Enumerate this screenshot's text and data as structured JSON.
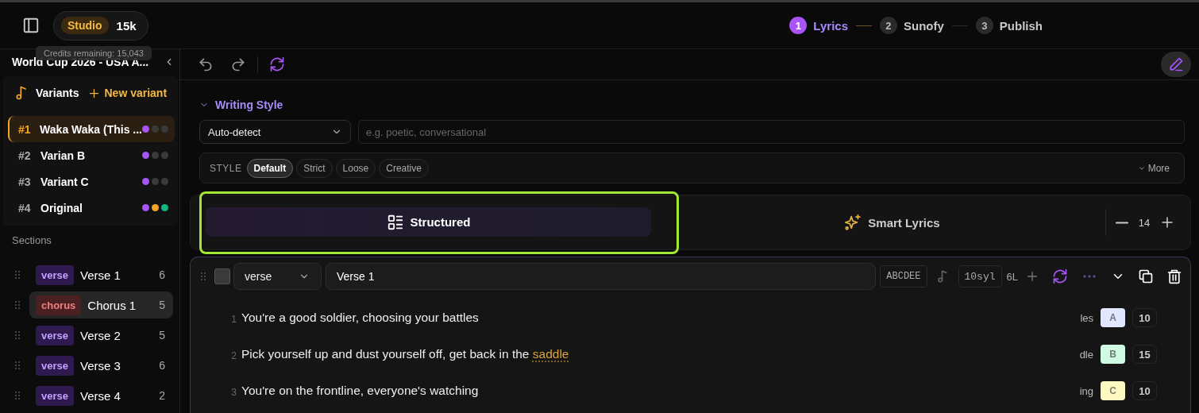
{
  "topbar": {
    "plan_badge": "Studio",
    "credits": "15k",
    "tooltip": "Credits remaining: 15,043",
    "steps": [
      {
        "number": "1",
        "label": "Lyrics",
        "selected": true
      },
      {
        "number": "2",
        "label": "Sunofy",
        "selected": false
      },
      {
        "number": "3",
        "label": "Publish",
        "selected": false
      }
    ]
  },
  "sidebar": {
    "project_title": "World Cup 2026 - USA A...",
    "variants_label": "Variants",
    "new_variant": "New variant",
    "variants": [
      {
        "number": "#1",
        "name": "Waka Waka (This ...",
        "selected": true,
        "dots": [
          {
            "color": "#a855f7"
          },
          {
            "color": "#3a3a3a"
          },
          {
            "color": "#3a3a3a"
          }
        ]
      },
      {
        "number": "#2",
        "name": "Varian B",
        "selected": false,
        "dots": [
          {
            "color": "#a855f7"
          },
          {
            "color": "#3a3a3a"
          },
          {
            "color": "#3a3a3a"
          }
        ]
      },
      {
        "number": "#3",
        "name": "Variant C",
        "selected": false,
        "dots": [
          {
            "color": "#a855f7"
          },
          {
            "color": "#3a3a3a"
          },
          {
            "color": "#3a3a3a"
          }
        ]
      },
      {
        "number": "#4",
        "name": "Original",
        "selected": false,
        "dots": [
          {
            "color": "#a855f7"
          },
          {
            "color": "#f5a524"
          },
          {
            "color": "#10b981"
          }
        ]
      }
    ],
    "sections_label": "Sections",
    "sections": [
      {
        "kind": "verse",
        "tag": "verse",
        "name": "Verse 1",
        "count": "6",
        "selected": false
      },
      {
        "kind": "chorus",
        "tag": "chorus",
        "name": "Chorus 1",
        "count": "5",
        "selected": true
      },
      {
        "kind": "verse",
        "tag": "verse",
        "name": "Verse 2",
        "count": "5",
        "selected": false
      },
      {
        "kind": "verse",
        "tag": "verse",
        "name": "Verse 3",
        "count": "6",
        "selected": false
      },
      {
        "kind": "verse",
        "tag": "verse",
        "name": "Verse 4",
        "count": "2",
        "selected": false
      }
    ]
  },
  "editor": {
    "writing_style": {
      "title": "Writing Style",
      "mode": "Auto-detect",
      "placeholder": "e.g. poetic, conversational",
      "style_label": "STYLE",
      "options": [
        {
          "label": "Default",
          "selected": true
        },
        {
          "label": "Strict",
          "selected": false
        },
        {
          "label": "Loose",
          "selected": false
        },
        {
          "label": "Creative",
          "selected": false
        }
      ],
      "more": "More"
    },
    "modes": [
      {
        "kind": "structured",
        "label": "Structured",
        "selected": true,
        "highlighted": true
      },
      {
        "kind": "smart",
        "label": "Smart Lyrics",
        "selected": false,
        "highlighted": false
      }
    ],
    "line_count": "14",
    "section_card": {
      "checked": false,
      "type": "verse",
      "name": "Verse 1",
      "rhyme_scheme": "ABCDEE",
      "syllables": "10syl",
      "lines_count": "6L",
      "lines": [
        {
          "number": "1",
          "text": "You're a good soldier, choosing your battles",
          "ending": "les",
          "rhyme": "A",
          "color": "#e0e7ff",
          "syllables": "10"
        },
        {
          "number": "2",
          "text": "Pick yourself up and dust yourself off, get back in the",
          "flagged_word": "saddle",
          "ending": "dle",
          "rhyme": "B",
          "color": "#d1fae5",
          "syllables": "15"
        },
        {
          "number": "3",
          "text": "You're on the frontline, everyone's watching",
          "ending": "ing",
          "rhyme": "C",
          "color": "#fef9c3",
          "syllables": "10"
        }
      ]
    }
  }
}
